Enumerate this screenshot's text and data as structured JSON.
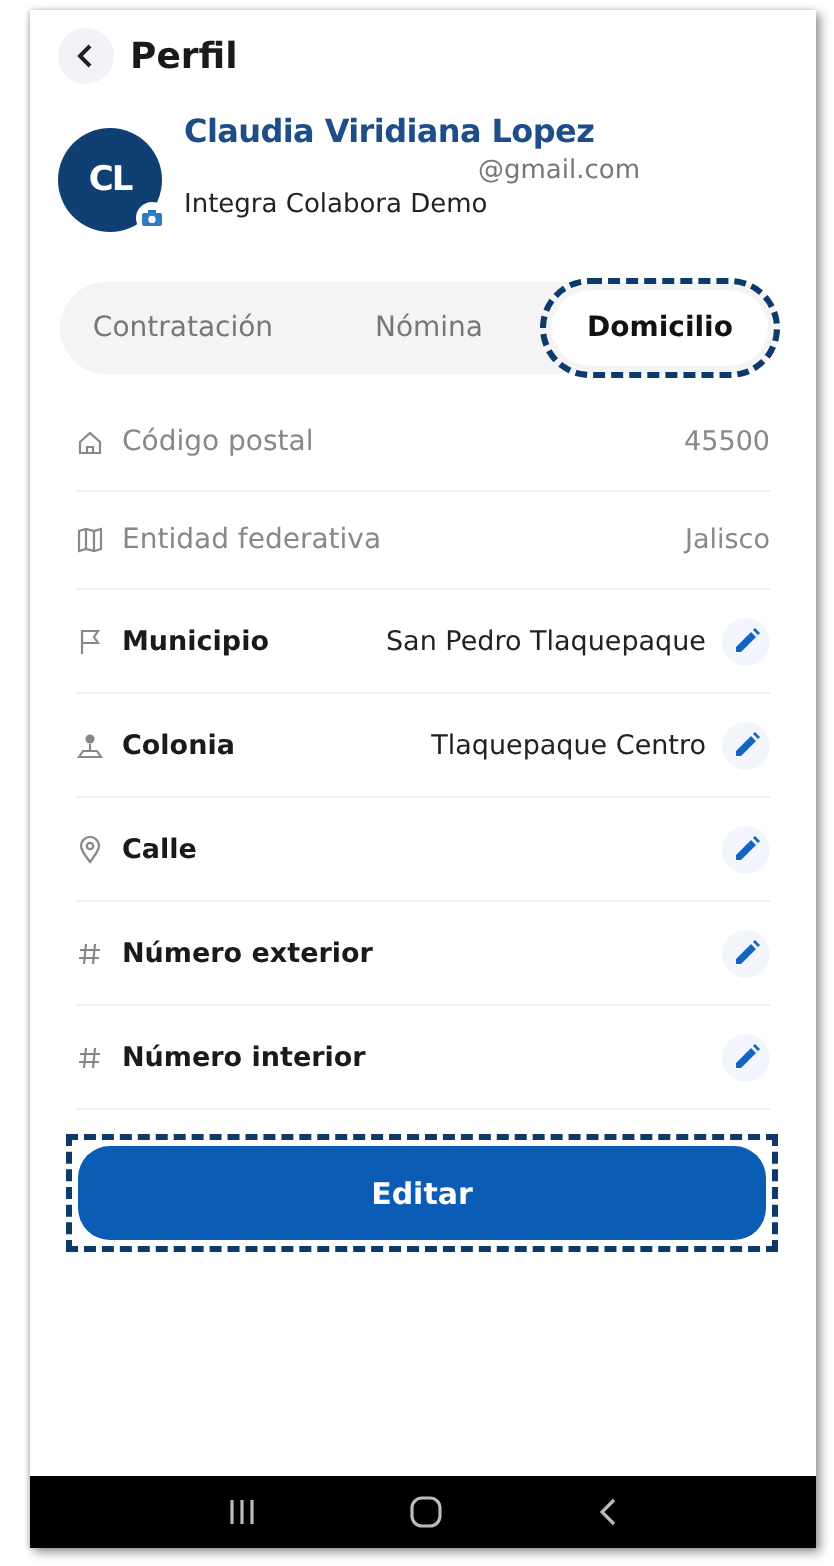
{
  "header": {
    "title": "Perfil"
  },
  "profile": {
    "initials": "CL",
    "name": "Claudia Viridiana Lopez",
    "email": "@gmail.com",
    "company": "Integra Colabora Demo"
  },
  "tabs": [
    {
      "label": "Contratación",
      "selected": false,
      "highlighted": false
    },
    {
      "label": "Nómina",
      "selected": false,
      "highlighted": false
    },
    {
      "label": "Domicilio",
      "selected": true,
      "highlighted": true
    }
  ],
  "fields": [
    {
      "label": "Código postal",
      "value": "45500",
      "editable": false
    },
    {
      "label": "Entidad federativa",
      "value": "Jalisco",
      "editable": false
    },
    {
      "label": "Municipio",
      "value": "San Pedro Tlaquepaque",
      "editable": true
    },
    {
      "label": "Colonia",
      "value": "Tlaquepaque Centro",
      "editable": true
    },
    {
      "label": "Calle",
      "editable": true
    },
    {
      "label": "Número exterior",
      "editable": true
    },
    {
      "label": "Número interior",
      "editable": true
    }
  ],
  "edit_button": {
    "label": "Editar",
    "highlighted": true
  }
}
